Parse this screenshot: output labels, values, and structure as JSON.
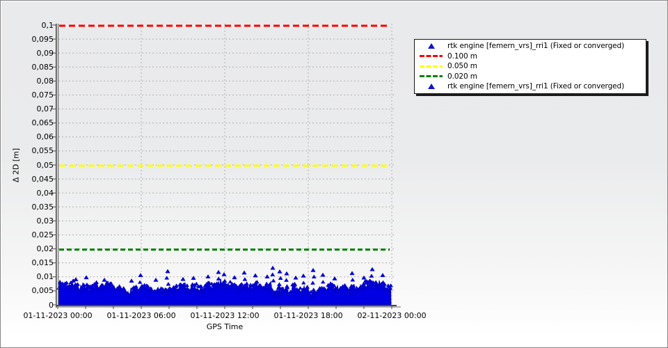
{
  "window": {
    "background_top": "#e9eaeb",
    "background_bottom": "#ffffff",
    "border_color": "#858585"
  },
  "chart_data": {
    "type": "scatter",
    "title": "",
    "xlabel": "GPS Time",
    "ylabel": "Δ 2D [m]",
    "ylim": [
      0,
      0.1
    ],
    "y_tick_step": 0.005,
    "y_tick_labels": [
      "0,1",
      "0,095",
      "0,09",
      "0,085",
      "0,08",
      "0,075",
      "0,07",
      "0,065",
      "0,06",
      "0,055",
      "0,05",
      "0,045",
      "0,04",
      "0,035",
      "0,03",
      "0,025",
      "0,02",
      "0,015",
      "0,01",
      "0,005",
      "0"
    ],
    "x_ticks": [
      {
        "hour": 0,
        "label": "01-11-2023 00:00"
      },
      {
        "hour": 6,
        "label": "01-11-2023 06:00"
      },
      {
        "hour": 12,
        "label": "01-11-2023 12:00"
      },
      {
        "hour": 18,
        "label": "01-11-2023 18:00"
      },
      {
        "hour": 24,
        "label": "02-11-2023 00:00"
      }
    ],
    "x_minor_tick_hours": 2,
    "grid": {
      "color": "#b0b0b0",
      "dash": "2 3",
      "enabled": true
    },
    "axis_color": "#4a4a4a",
    "axis_shadow_color": "#b2b2b2",
    "reference_lines": [
      {
        "value": 0.1,
        "color": "#ff0000",
        "label": "0.100 m",
        "dash": "9 5",
        "width": 3
      },
      {
        "value": 0.05,
        "color": "#ffff00",
        "label": "0.050 m",
        "dash": "9 5",
        "width": 3
      },
      {
        "value": 0.02,
        "color": "#008000",
        "label": "0.020 m",
        "dash": "7 4",
        "width": 3
      }
    ],
    "series": [
      {
        "name": "rtk engine [femern_vrs]_rri1 (Fixed or converged)",
        "marker": "triangle",
        "color": "#0000e2",
        "edge_color": "#0000b0",
        "x_range_hours": [
          0.08,
          23.95
        ],
        "band": {
          "base_m": 0.0048,
          "jitter_m": 0.0026,
          "typical_max_m": 0.009,
          "description": "dense noise band of 2D deltas between 0 and ~0.009 m over 24 h"
        },
        "spikes_hour_value": [
          [
            1.3,
            0.0098
          ],
          [
            2.05,
            0.0105
          ],
          [
            3.35,
            0.0096
          ],
          [
            5.3,
            0.0093
          ],
          [
            5.95,
            0.0113
          ],
          [
            7.05,
            0.0096
          ],
          [
            7.9,
            0.0127
          ],
          [
            9.0,
            0.0099
          ],
          [
            9.75,
            0.0103
          ],
          [
            10.8,
            0.0108
          ],
          [
            11.55,
            0.0124
          ],
          [
            11.95,
            0.0116
          ],
          [
            12.7,
            0.0105
          ],
          [
            13.4,
            0.0122
          ],
          [
            14.2,
            0.0112
          ],
          [
            15.05,
            0.0108
          ],
          [
            15.45,
            0.0139
          ],
          [
            15.95,
            0.0126
          ],
          [
            16.45,
            0.0119
          ],
          [
            17.1,
            0.0104
          ],
          [
            17.65,
            0.0111
          ],
          [
            18.35,
            0.0131
          ],
          [
            19.05,
            0.0114
          ],
          [
            19.9,
            0.0101
          ],
          [
            21.15,
            0.012
          ],
          [
            22.0,
            0.0104
          ],
          [
            22.6,
            0.0134
          ],
          [
            23.35,
            0.0113
          ]
        ]
      }
    ],
    "legend_position": "top-right-outside"
  },
  "legend": {
    "background": "#ffffff",
    "border_color": "#161616",
    "entries": [
      {
        "marker": "triangle",
        "color": "#1212cc",
        "label": "rtk engine [femern_vrs]_rri1 (Fixed or converged)"
      },
      {
        "marker": "dash",
        "color": "#ff0000",
        "label": "0.100 m"
      },
      {
        "marker": "dash",
        "color": "#ffff00",
        "label": "0.050 m"
      },
      {
        "marker": "dash",
        "color": "#008000",
        "label": "0.020 m"
      },
      {
        "marker": "triangle",
        "color": "#1212cc",
        "label": "rtk engine [femern_vrs]_rri1 (Fixed or converged)"
      }
    ]
  }
}
